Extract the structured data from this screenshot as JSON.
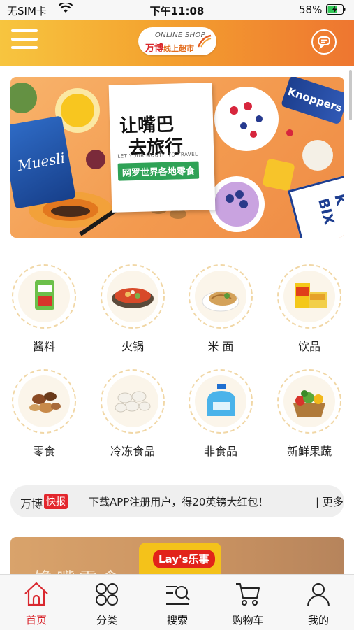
{
  "status_bar": {
    "carrier": "无SIM卡",
    "time": "下午11:08",
    "battery": "58%"
  },
  "header": {
    "logo_en": "ONLINE SHOP",
    "logo_brand": "万博",
    "logo_suffix": "线上超市"
  },
  "banner": {
    "line1": "让嘴巴",
    "line2": "去旅行",
    "subtitle_en": "LET YOUR MOUTH TO TRAVEL",
    "tag": "网罗世界各地零食",
    "pack1": "Muesli",
    "pack2": "Knoppers",
    "pack3": "K BIX"
  },
  "categories": [
    {
      "label": "酱料",
      "icon": "sauce-icon"
    },
    {
      "label": "火锅",
      "icon": "hotpot-icon"
    },
    {
      "label": "米 面",
      "icon": "noodles-icon"
    },
    {
      "label": "饮品",
      "icon": "drinks-icon"
    },
    {
      "label": "零食",
      "icon": "snacks-icon"
    },
    {
      "label": "冷冻食品",
      "icon": "dumplings-icon"
    },
    {
      "label": "非食品",
      "icon": "detergent-icon"
    },
    {
      "label": "新鲜果蔬",
      "icon": "fruit-basket-icon"
    }
  ],
  "news": {
    "brand": "万博",
    "badge": "快报",
    "text": "下载APP注册用户，得20英镑大红包！",
    "more": "| 更多"
  },
  "promo": {
    "title": "馋嘴零食",
    "brand_pack": "Lay's乐事"
  },
  "tabs": [
    {
      "label": "首页",
      "icon": "home-icon",
      "active": true
    },
    {
      "label": "分类",
      "icon": "category-icon",
      "active": false
    },
    {
      "label": "搜索",
      "icon": "search-icon",
      "active": false
    },
    {
      "label": "购物车",
      "icon": "cart-icon",
      "active": false
    },
    {
      "label": "我的",
      "icon": "profile-icon",
      "active": false
    }
  ],
  "colors": {
    "accent": "#d9282f",
    "header_start": "#f7c53f",
    "header_end": "#ee7630"
  }
}
